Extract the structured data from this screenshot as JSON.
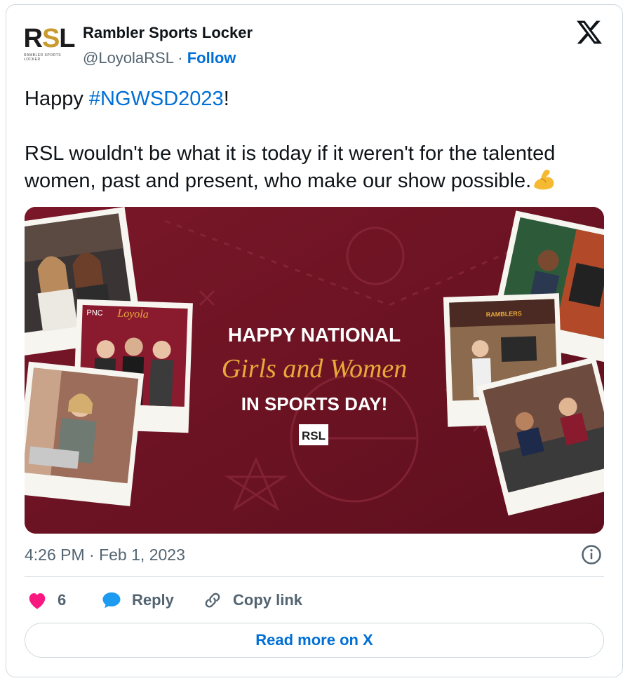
{
  "author": {
    "name": "Rambler Sports Locker",
    "handle": "@LoyolaRSL",
    "separator": "·",
    "follow_label": "Follow",
    "avatar_logo": "RSL",
    "avatar_subtitle": "RAMBLER SPORTS LOCKER"
  },
  "tweet": {
    "line1_prefix": "Happy ",
    "hashtag": "#NGWSD2023",
    "line1_suffix": "!",
    "paragraph2": "RSL wouldn't be what it is today if it weren't for the talented women, past and present, who make our show possible.",
    "emoji_icon": "flexed-biceps-emoji"
  },
  "media": {
    "headline_top": "HAPPY NATIONAL",
    "headline_script": "Girls and Women",
    "headline_bottom": "IN SPORTS DAY!",
    "badge": "RSL",
    "banner_text_1": "PNC",
    "banner_text_2": "Loyola",
    "banner_text_3": "RAMBLERS",
    "background_color": "#6e1424",
    "accent_color": "#e9a93a"
  },
  "meta": {
    "timestamp": "4:26 PM · Feb 1, 2023",
    "info_icon": "info-icon"
  },
  "actions": {
    "like_count": "6",
    "reply_label": "Reply",
    "copy_link_label": "Copy link"
  },
  "read_more_label": "Read more on X",
  "colors": {
    "link": "#006fd6",
    "muted": "#536471",
    "like": "#f91880",
    "reply": "#1d9bf0",
    "border": "#cfd9de"
  }
}
